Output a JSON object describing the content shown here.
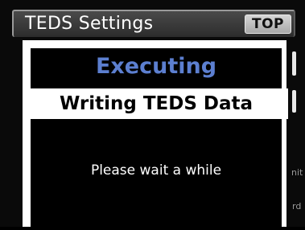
{
  "header": {
    "title": "TEDS Settings",
    "top_button_label": "TOP"
  },
  "dialog": {
    "status": "Executing",
    "message": "Writing TEDS Data",
    "wait_text": "Please wait a while"
  },
  "background": {
    "right_fragment_1": "nit",
    "right_fragment_2": "rd"
  },
  "colors": {
    "status_accent": "#5c7fd0",
    "background": "#000000",
    "dialog_frame": "#ffffff"
  }
}
